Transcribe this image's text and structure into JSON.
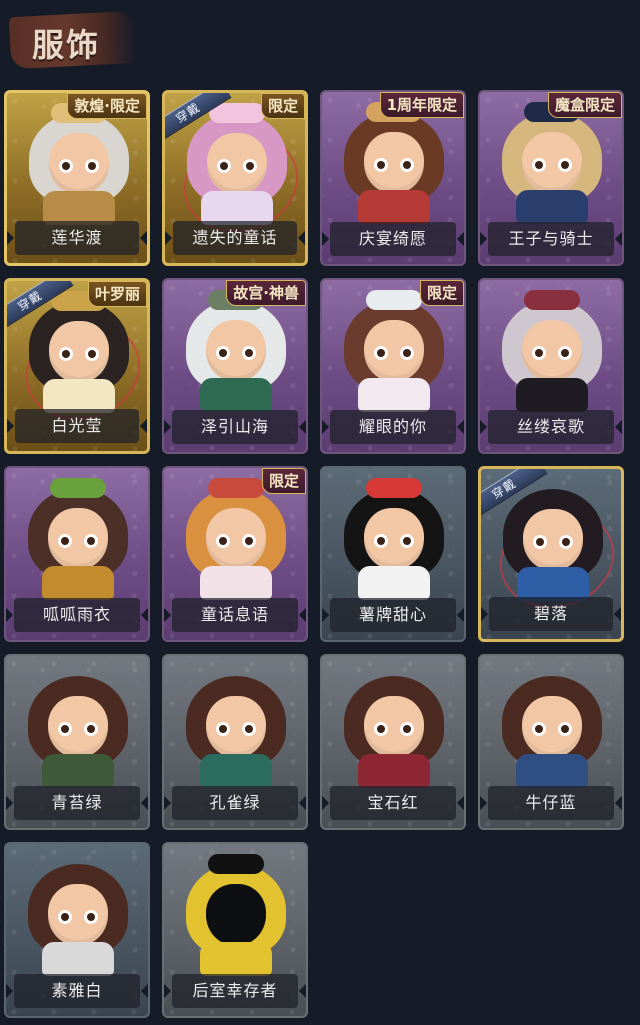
{
  "header": {
    "title": "服饰"
  },
  "colors": {
    "background": "#161b28",
    "gold": "#e5c565",
    "purple": "#8e6ca3",
    "blue": "#5c6b78",
    "grey": "#737980",
    "equipped_ribbon": "#4b5f88",
    "ring": "#d13743"
  },
  "cards": [
    {
      "name": "莲华渡",
      "tier": "gold",
      "badge": "敦煌·限定",
      "equipped": false
    },
    {
      "name": "遗失的童话",
      "tier": "gold",
      "badge": "限定",
      "equipped": true,
      "equipped_label": "穿戴"
    },
    {
      "name": "庆宴绮愿",
      "tier": "purple",
      "badge": "1周年限定",
      "equipped": false
    },
    {
      "name": "王子与骑士",
      "tier": "purple",
      "badge": "魔盒限定",
      "equipped": false
    },
    {
      "name": "白光莹",
      "tier": "gold",
      "badge": "叶罗丽",
      "equipped": true,
      "equipped_label": "穿戴"
    },
    {
      "name": "泽引山海",
      "tier": "purple",
      "badge": "故宫·神兽",
      "equipped": false
    },
    {
      "name": "耀眼的你",
      "tier": "purple",
      "badge": "限定",
      "equipped": false
    },
    {
      "name": "丝缕哀歌",
      "tier": "purple",
      "badge": "",
      "equipped": false
    },
    {
      "name": "呱呱雨衣",
      "tier": "purple",
      "badge": "",
      "equipped": false
    },
    {
      "name": "童话息语",
      "tier": "purple",
      "badge": "限定",
      "equipped": false
    },
    {
      "name": "薯牌甜心",
      "tier": "blue",
      "badge": "",
      "equipped": false
    },
    {
      "name": "碧落",
      "tier": "blue",
      "badge": "",
      "equipped": true,
      "equipped_label": "穿戴"
    },
    {
      "name": "青苔绿",
      "tier": "grey",
      "badge": "",
      "equipped": false
    },
    {
      "name": "孔雀绿",
      "tier": "grey",
      "badge": "",
      "equipped": false
    },
    {
      "name": "宝石红",
      "tier": "grey",
      "badge": "",
      "equipped": false
    },
    {
      "name": "牛仔蓝",
      "tier": "grey",
      "badge": "",
      "equipped": false
    },
    {
      "name": "素雅白",
      "tier": "blue",
      "badge": "",
      "equipped": false
    },
    {
      "name": "后室幸存者",
      "tier": "grey",
      "badge": "",
      "equipped": false
    }
  ]
}
